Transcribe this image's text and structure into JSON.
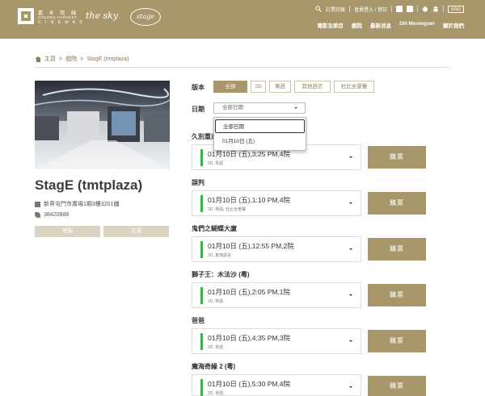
{
  "header": {
    "logo_gh": {
      "line1": "嘉 禾 院 線",
      "line2": "GOLDEN HARVEST",
      "line3": "C I N E M A S"
    },
    "logo_sky": "the sky",
    "logo_stage": "stage",
    "toplinks": {
      "bookings": "訂票記錄",
      "login": "會員登入 / 登記",
      "lang": "ENG"
    },
    "nav": [
      "電影及節目",
      "戲院",
      "最新消息",
      "GH Moviegoer",
      "關於我們"
    ]
  },
  "breadcrumb": {
    "home": "主頁",
    "sep": ">",
    "cinemas": "戲院",
    "current": "StagE (tmtplaza)"
  },
  "cinema": {
    "name": "StagE (tmtplaza)",
    "address": "新界屯門市廣場1期3樓3201舖",
    "phone": "38420888",
    "map_button": "地圖",
    "transport_button": "交通"
  },
  "filters": {
    "version_label": "版本",
    "versions": [
      "全部",
      "2D",
      "粵語",
      "其他語言",
      "杜比全景聲"
    ],
    "active_version": "全部",
    "date_label": "日期",
    "date_value": "全部日期",
    "date_options": [
      "全部日期",
      "01月10日 (五)"
    ]
  },
  "buy_label": "購票",
  "movies": [
    {
      "title": "久別重逢",
      "time": "01月10日 (五),3:25 PM,4院",
      "format": "2D, 粵語"
    },
    {
      "title": "誤判",
      "time": "01月10日 (五),1:10 PM,4院",
      "format": "2D, 粵語, 杜比全景聲"
    },
    {
      "title": "鬼們之蝴蝶大廈",
      "time": "01月10日 (五),12:55 PM,2院",
      "format": "2D, 其他語言"
    },
    {
      "title": "獅子王：木法沙 (粵)",
      "time": "01月10日 (五),2:05 PM,1院",
      "format": "2D, 粵語"
    },
    {
      "title": "爸爸",
      "time": "01月10日 (五),4:35 PM,3院",
      "format": "2D, 粵語"
    },
    {
      "title": "魔海奇緣 2 (粵)",
      "time": "01月10日 (五),5:30 PM,4院",
      "format": "2D, 粵語"
    }
  ],
  "colors": {
    "gold": "#a8976a",
    "green": "#3db24a"
  }
}
